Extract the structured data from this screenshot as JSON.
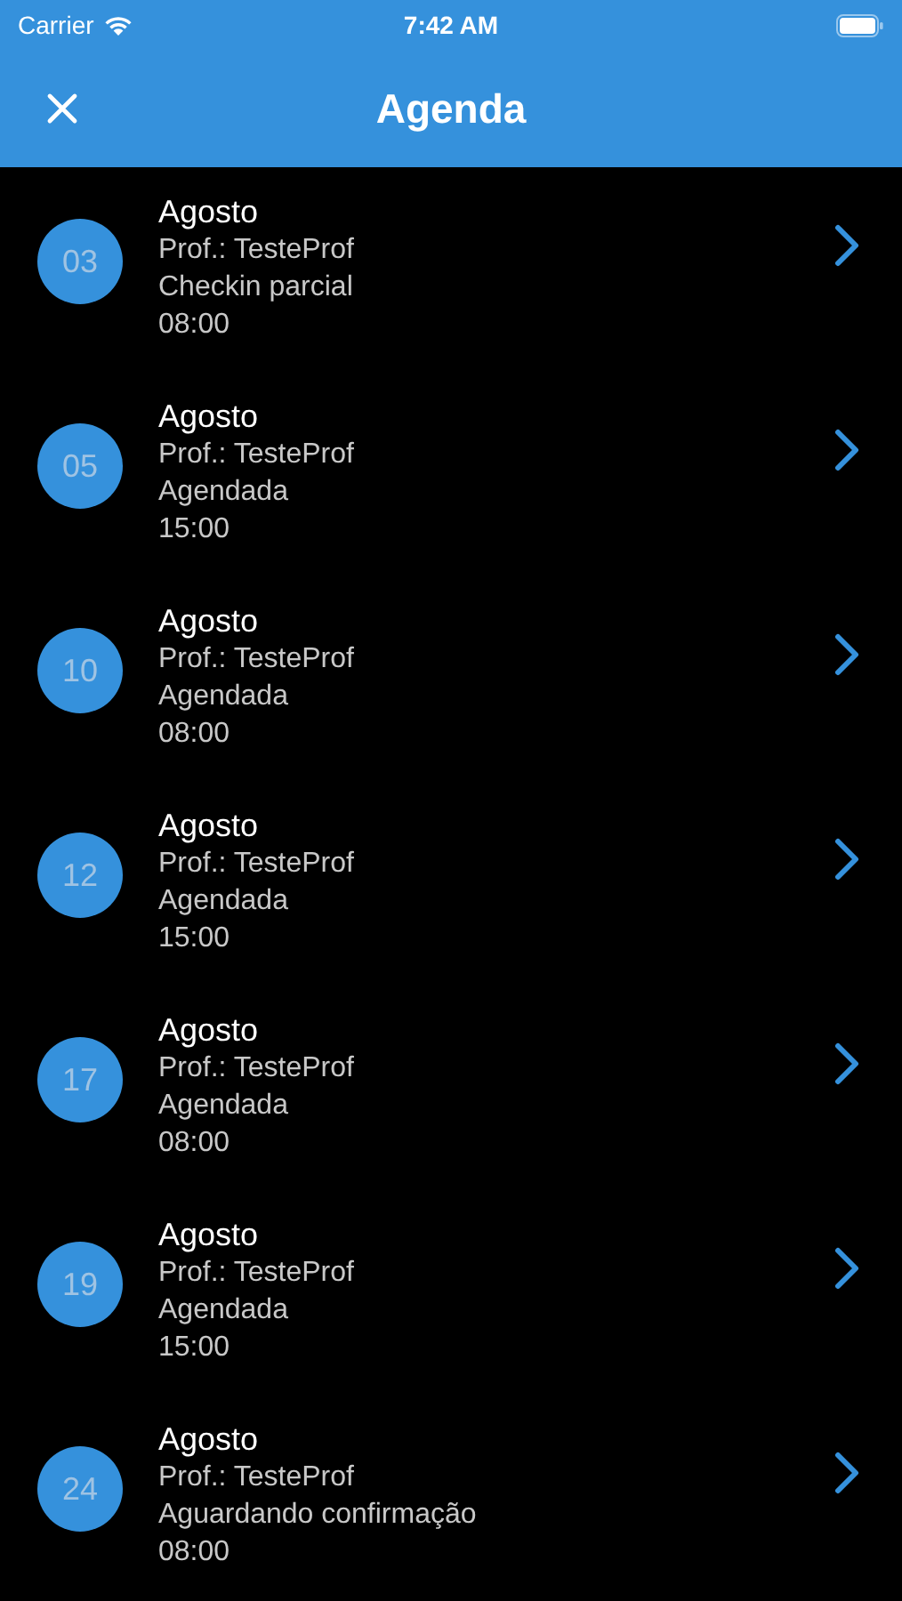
{
  "status_bar": {
    "carrier": "Carrier",
    "time": "7:42 AM"
  },
  "header": {
    "title": "Agenda"
  },
  "appointments": [
    {
      "day": "03",
      "month": "Agosto",
      "teacher": "Prof.: TesteProf",
      "status": "Checkin parcial",
      "time": "08:00"
    },
    {
      "day": "05",
      "month": "Agosto",
      "teacher": "Prof.: TesteProf",
      "status": "Agendada",
      "time": "15:00"
    },
    {
      "day": "10",
      "month": "Agosto",
      "teacher": "Prof.: TesteProf",
      "status": "Agendada",
      "time": "08:00"
    },
    {
      "day": "12",
      "month": "Agosto",
      "teacher": "Prof.: TesteProf",
      "status": "Agendada",
      "time": "15:00"
    },
    {
      "day": "17",
      "month": "Agosto",
      "teacher": "Prof.: TesteProf",
      "status": "Agendada",
      "time": "08:00"
    },
    {
      "day": "19",
      "month": "Agosto",
      "teacher": "Prof.: TesteProf",
      "status": "Agendada",
      "time": "15:00"
    },
    {
      "day": "24",
      "month": "Agosto",
      "teacher": "Prof.: TesteProf",
      "status": "Aguardando confirmação",
      "time": "08:00"
    }
  ]
}
